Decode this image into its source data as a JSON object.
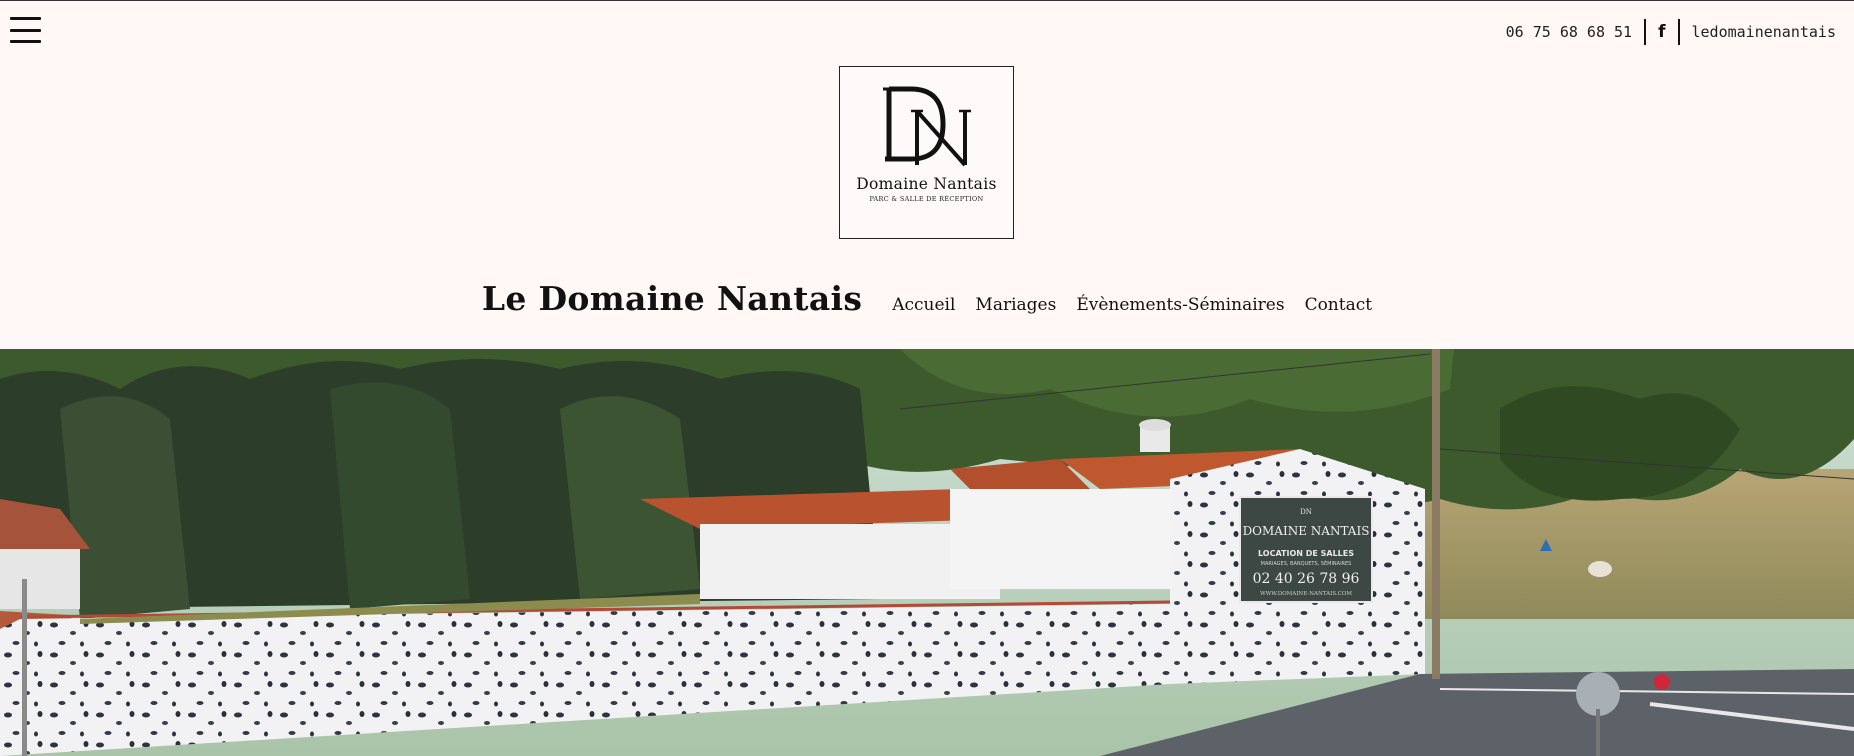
{
  "header": {
    "menu_icon": "hamburger-menu-icon",
    "phone": "06 75 68 68 51",
    "social_icon": "facebook-icon",
    "social_label": "f",
    "social_handle": "ledomainenantais"
  },
  "logo": {
    "monogram": "DN",
    "name": "Domaine Nantais",
    "subtitle": "PARC & SALLE DE RÉCEPTION"
  },
  "nav": {
    "brand": "Le Domaine Nantais",
    "items": [
      "Accueil",
      "Mariages",
      "Évènements-Séminaires",
      "Contact"
    ]
  },
  "hero": {
    "sign_mono": "DN",
    "sign_name": "DOMAINE NANTAIS",
    "sign_line1": "LOCATION DE SALLES",
    "sign_line2": "MARIAGES, BANQUETS, SÉMINAIRES",
    "sign_phone": "02 40 26 78 96",
    "sign_url": "WWW.DOMAINE-NANTAIS.COM"
  },
  "colors": {
    "background": "#fff8f6",
    "text": "#111111",
    "roof": "#b9532f",
    "sign": "#3d4743"
  }
}
